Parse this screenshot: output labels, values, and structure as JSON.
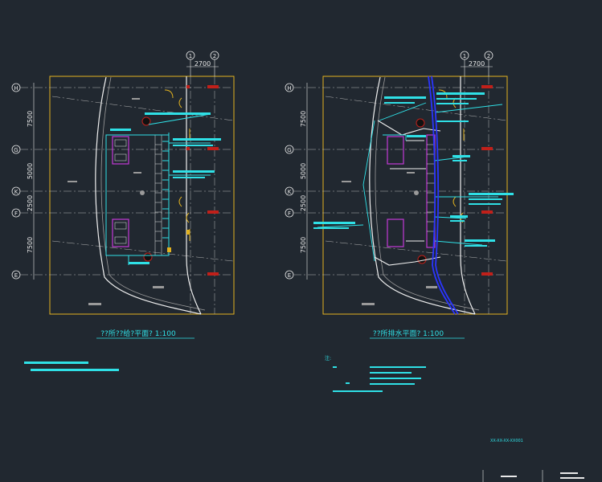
{
  "colors": {
    "background": "#212830",
    "frame": "#e2b21f",
    "cyan": "#2fe0e6",
    "magenta": "#c33ad6",
    "blue": "#2a35ff",
    "grid": "#b8b8b8",
    "wall": "#f0f0f0",
    "red": "#c0201a"
  },
  "dim_2700": "2700",
  "axis_top": [
    "1",
    "2"
  ],
  "axis_side": [
    "H",
    "G",
    "K",
    "F",
    "E"
  ],
  "dims_vertical": [
    "7500",
    "5000",
    "2500",
    "7500"
  ],
  "left_plan": {
    "title": "??所??给?平面?  1:100"
  },
  "right_plan": {
    "title": "??所排水平面?  1:100"
  },
  "notes_right_header": "注:",
  "drawing_number": "XX-XX-XX-XX001"
}
